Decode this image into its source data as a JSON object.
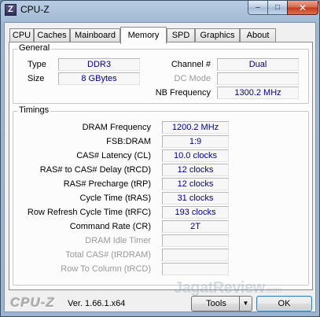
{
  "window": {
    "title": "CPU-Z",
    "icon_letter": "Z",
    "controls": {
      "minimize": "–",
      "maximize": "□",
      "close": "✕"
    }
  },
  "tabs": [
    {
      "label": "CPU",
      "active": false
    },
    {
      "label": "Caches",
      "active": false
    },
    {
      "label": "Mainboard",
      "active": false
    },
    {
      "label": "Memory",
      "active": true
    },
    {
      "label": "SPD",
      "active": false
    },
    {
      "label": "Graphics",
      "active": false
    },
    {
      "label": "About",
      "active": false
    }
  ],
  "general": {
    "legend": "General",
    "type_label": "Type",
    "type_value": "DDR3",
    "size_label": "Size",
    "size_value": "8 GBytes",
    "channel_label": "Channel #",
    "channel_value": "Dual",
    "dc_mode_label": "DC Mode",
    "dc_mode_value": "",
    "nb_freq_label": "NB Frequency",
    "nb_freq_value": "1300.2 MHz"
  },
  "timings": {
    "legend": "Timings",
    "rows": [
      {
        "label": "DRAM Frequency",
        "value": "1200.2 MHz",
        "enabled": true
      },
      {
        "label": "FSB:DRAM",
        "value": "1:9",
        "enabled": true
      },
      {
        "label": "CAS# Latency (CL)",
        "value": "10.0 clocks",
        "enabled": true
      },
      {
        "label": "RAS# to CAS# Delay (tRCD)",
        "value": "12 clocks",
        "enabled": true
      },
      {
        "label": "RAS# Precharge (tRP)",
        "value": "12 clocks",
        "enabled": true
      },
      {
        "label": "Cycle Time (tRAS)",
        "value": "31 clocks",
        "enabled": true
      },
      {
        "label": "Row Refresh Cycle Time (tRFC)",
        "value": "193 clocks",
        "enabled": true
      },
      {
        "label": "Command Rate (CR)",
        "value": "2T",
        "enabled": true
      },
      {
        "label": "DRAM Idle Timer",
        "value": "",
        "enabled": false
      },
      {
        "label": "Total CAS# (tRDRAM)",
        "value": "",
        "enabled": false
      },
      {
        "label": "Row To Column (tRCD)",
        "value": "",
        "enabled": false
      }
    ]
  },
  "watermark": {
    "brand": "JagatReview",
    "suffix": ".com"
  },
  "footer": {
    "logo": "CPU-Z",
    "version": "Ver. 1.66.1.x64",
    "tools_label": "Tools",
    "tools_arrow": "▼",
    "ok_label": "OK"
  }
}
